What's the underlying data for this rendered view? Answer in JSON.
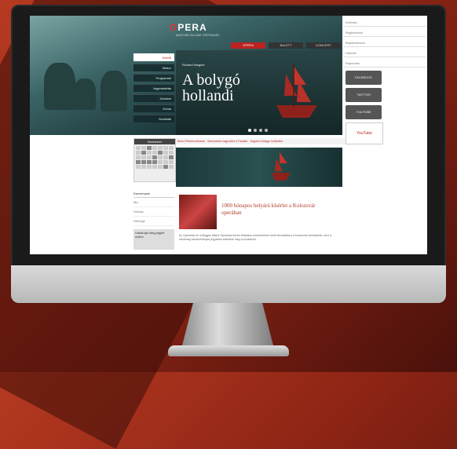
{
  "header": {
    "logo_o": "O",
    "logo_rest": "PERA",
    "logo_sub": "MAGYAR ÁLLAMI OPERAHÁZ"
  },
  "top_nav": [
    {
      "label": "OPERA"
    },
    {
      "label": "BALETT"
    },
    {
      "label": "KONCERT"
    }
  ],
  "left_nav": [
    {
      "label": "Kezdő"
    },
    {
      "label": "Műsor"
    },
    {
      "label": "Programok"
    },
    {
      "label": "Jegyvásárlás"
    },
    {
      "label": "Zenekar"
    },
    {
      "label": "Kórus"
    },
    {
      "label": "Szólisták"
    }
  ],
  "feature": {
    "eyebrow": "Richard Wagner",
    "title": "A bolygó hollandi"
  },
  "right_sidebar": {
    "fields": [
      "Keresés",
      "Regisztráció",
      "Bejelentkezés",
      "Hírlevél",
      "Kapcsolat"
    ],
    "buttons": [
      "FACEBOOK",
      "TWITTER",
      "YOUTUBE"
    ],
    "badge": "YouTube"
  },
  "ticker": "Bécsi Filharmonikusok · Szenzációs nagy siker a Traviata · Jegyek a Bolygó hollandira",
  "calendar": {
    "month": "December"
  },
  "left_box": {
    "heading": "Események",
    "rows": [
      "Ma",
      "Holnap",
      "Hétvége"
    ],
    "grey": "Vásárolja meg jegyét online"
  },
  "article": {
    "headline": "1000 hónapos helyárú kísérlet a Kolozsvár operában",
    "body": "Az Operaház és a Magyar Állami Operaház közös előadása novemberben kerül bemutatásra a kolozsvári színházban, ahol a közönség kedvezményes jegyekkel tekintheti meg a produkciót."
  }
}
